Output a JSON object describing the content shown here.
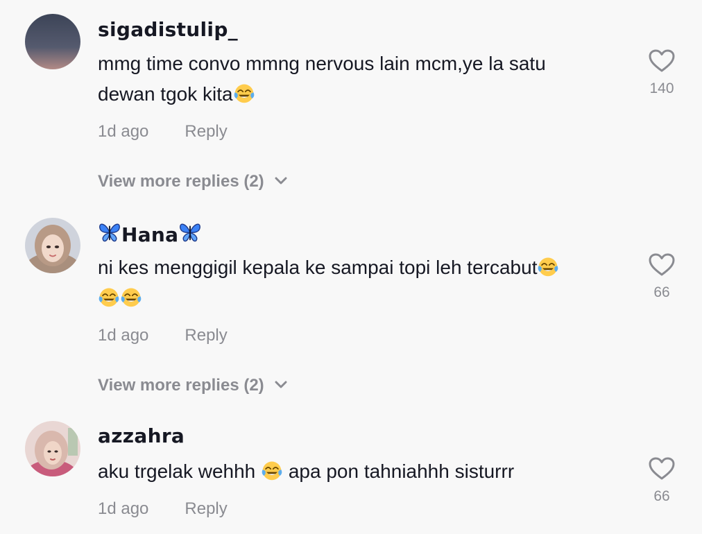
{
  "comments": [
    {
      "username": "sigadistulip_",
      "text_line1": "mmg time convo mmng nervous lain mcm,ye la satu",
      "text_line2": "dewan tgok kita",
      "time": "1d ago",
      "reply_label": "Reply",
      "likes": "140",
      "view_more": "View more replies (2)",
      "avatar": "avatar-gradient-dusk"
    },
    {
      "username_prefix_icon": "butterfly-icon",
      "username": "Hana",
      "username_suffix_icon": "butterfly-icon",
      "text_line1": "ni kes menggigil kepala ke sampai topi leh tercabut",
      "text_line2": "",
      "time": "1d ago",
      "reply_label": "Reply",
      "likes": "66",
      "view_more": "View more replies (2)",
      "avatar": "avatar-hijab-portrait"
    },
    {
      "username": "azzahra",
      "text_before_emoji": "aku trgelak wehhh ",
      "text_after_emoji": " apa pon tahniahhh sisturrr",
      "time": "1d ago",
      "reply_label": "Reply",
      "likes": "66",
      "avatar": "avatar-hijab-pink"
    }
  ],
  "icons": {
    "like": "heart-outline-icon",
    "expand": "chevron-down-icon",
    "emoji": "face-with-tears-of-joy-icon"
  },
  "colors": {
    "background": "#f8f8f8",
    "primary_text": "#161823",
    "secondary_text": "#8a8b91",
    "butterfly": "#3b82f6"
  }
}
